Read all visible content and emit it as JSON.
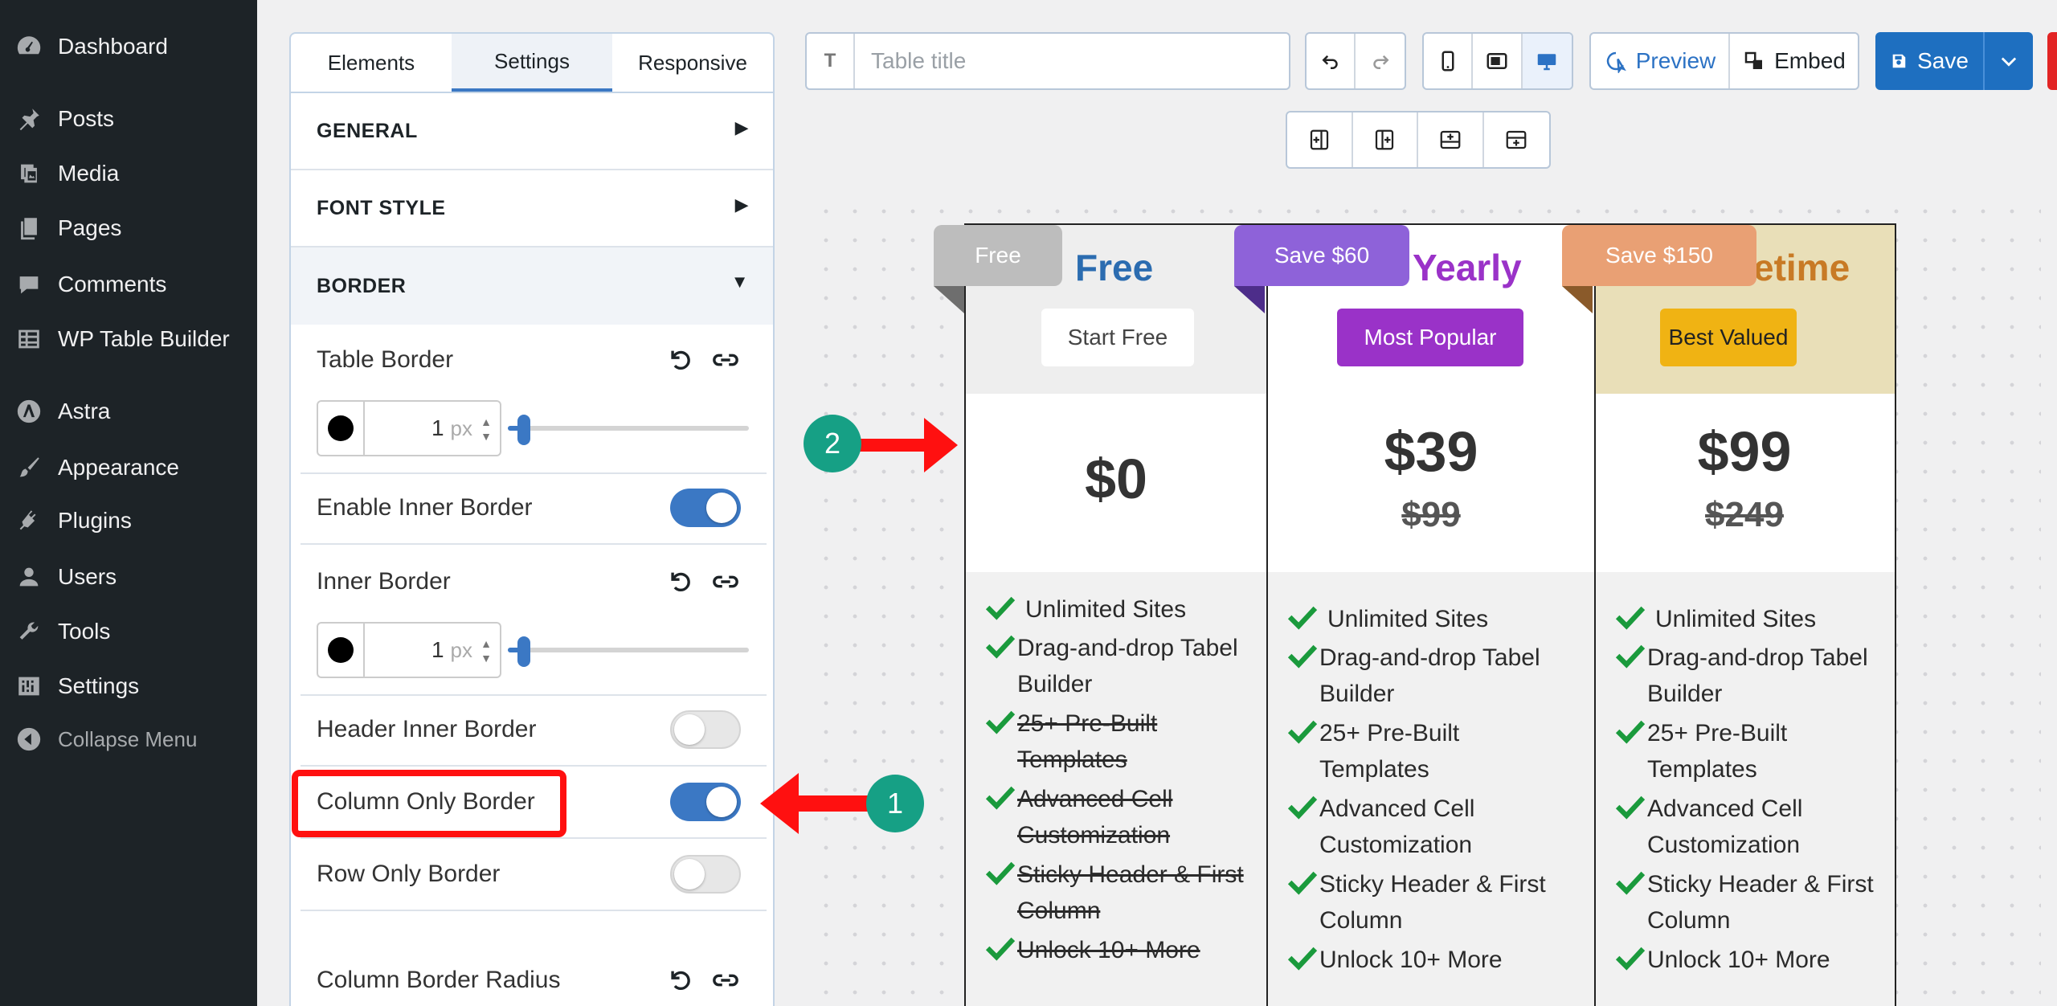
{
  "wp_menu": {
    "items": [
      {
        "label": "Dashboard",
        "icon": "dashboard-icon"
      },
      {
        "label": "Posts",
        "icon": "pin-icon"
      },
      {
        "label": "Media",
        "icon": "media-icon"
      },
      {
        "label": "Pages",
        "icon": "pages-icon"
      },
      {
        "label": "Comments",
        "icon": "comment-icon"
      },
      {
        "label": "WP Table Builder",
        "icon": "table-icon"
      },
      {
        "label": "Astra",
        "icon": "astra-icon"
      },
      {
        "label": "Appearance",
        "icon": "brush-icon"
      },
      {
        "label": "Plugins",
        "icon": "plug-icon"
      },
      {
        "label": "Users",
        "icon": "user-icon"
      },
      {
        "label": "Tools",
        "icon": "wrench-icon"
      },
      {
        "label": "Settings",
        "icon": "sliders-icon"
      }
    ],
    "collapse_label": "Collapse Menu"
  },
  "panel": {
    "tabs": [
      "Elements",
      "Settings",
      "Responsive"
    ],
    "active_tab": "Settings",
    "sections": {
      "general": "GENERAL",
      "font_style": "FONT STYLE",
      "border": "BORDER"
    },
    "border": {
      "table_border": {
        "label": "Table Border",
        "value": "1",
        "unit": "px",
        "color": "#000000"
      },
      "enable_inner_border": {
        "label": "Enable Inner Border",
        "on": true
      },
      "inner_border": {
        "label": "Inner Border",
        "value": "1",
        "unit": "px",
        "color": "#000000"
      },
      "header_inner_border": {
        "label": "Header Inner Border",
        "on": false
      },
      "column_only_border": {
        "label": "Column Only Border",
        "on": true
      },
      "row_only_border": {
        "label": "Row Only Border",
        "on": false
      },
      "column_border_radius": {
        "label": "Column Border Radius"
      }
    }
  },
  "toolbar": {
    "title_placeholder": "Table title",
    "title_icon": "T",
    "preview_label": "Preview",
    "embed_label": "Embed",
    "save_label": "Save"
  },
  "pricing": {
    "columns": [
      {
        "ribbon": "Free",
        "ribbon_color": "#bdbdbd",
        "name": "Free",
        "name_color": "#2b6cb0",
        "button": "Start Free",
        "header_bg": "#eeeeee",
        "price": "$0",
        "old_price": "",
        "features": [
          {
            "text": "Unlimited Sites",
            "struck": false
          },
          {
            "text": "Drag-and-drop Tabel Builder",
            "struck": false
          },
          {
            "text": "25+ Pre-Built Templates",
            "struck": true
          },
          {
            "text": "Advanced Cell Customization",
            "struck": true
          },
          {
            "text": "Sticky Header & First Column",
            "struck": true
          },
          {
            "text": "Unlock 10+ More",
            "struck": true
          }
        ]
      },
      {
        "ribbon": "Save $60",
        "ribbon_color": "#8e62d9",
        "name": "Yearly",
        "name_color": "#9a32c8",
        "button": "Most Popular",
        "header_bg": "#ffffff",
        "price": "$39",
        "old_price": "$99",
        "features": [
          {
            "text": "Unlimited Sites",
            "struck": false
          },
          {
            "text": "Drag-and-drop Tabel Builder",
            "struck": false
          },
          {
            "text": "25+ Pre-Built Templates",
            "struck": false
          },
          {
            "text": "Advanced Cell Customization",
            "struck": false
          },
          {
            "text": "Sticky Header & First Column",
            "struck": false
          },
          {
            "text": "Unlock 10+ More",
            "struck": false
          }
        ]
      },
      {
        "ribbon": "Save $150",
        "ribbon_color": "#e9a074",
        "name": "etime",
        "name_color": "#c87a25",
        "button": "Best Valued",
        "header_bg": "#e9dfb8",
        "price": "$99",
        "old_price": "$249",
        "features": [
          {
            "text": "Unlimited Sites",
            "struck": false
          },
          {
            "text": "Drag-and-drop Tabel Builder",
            "struck": false
          },
          {
            "text": "25+ Pre-Built Templates",
            "struck": false
          },
          {
            "text": "Advanced Cell Customization",
            "struck": false
          },
          {
            "text": "Sticky Header & First Column",
            "struck": false
          },
          {
            "text": "Unlock 10+ More",
            "struck": false
          }
        ]
      }
    ]
  },
  "annotations": {
    "badge_1": "1",
    "badge_2": "2"
  },
  "colors": {
    "accent": "#3b78c4",
    "save": "#1e6fc0",
    "check": "#1a9a3c",
    "annotation_red": "#ff1010",
    "annotation_badge": "#16a085"
  }
}
